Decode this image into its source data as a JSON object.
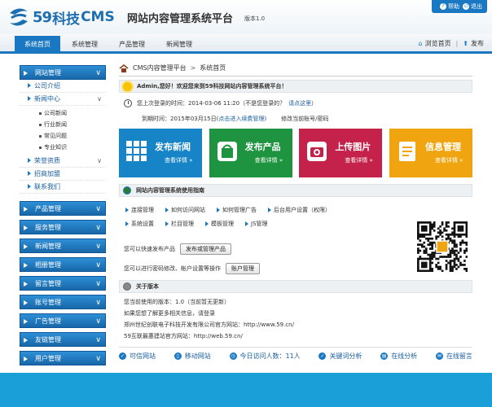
{
  "brand": {
    "logo_59": "59",
    "logo_tech": "科技",
    "logo_cms": "CMS",
    "system_title": "网站内容管理系统平台",
    "version": "版本1.0"
  },
  "top_links": {
    "help": "帮助",
    "logout": "退出"
  },
  "nav": {
    "tabs": [
      "系统首页",
      "系统管理",
      "产品管理",
      "新闻管理"
    ],
    "browse": "浏览首页",
    "publish": "发布"
  },
  "sidebar": {
    "site_manage": "网站管理",
    "company_intro": "公司介绍",
    "news_center": "新闻中心",
    "news_subs": [
      "公司新闻",
      "行业新闻",
      "常见问题",
      "专业知识"
    ],
    "honors": "荣誉资质",
    "recruit": "招商加盟",
    "contact": "联系我们",
    "groups": [
      "产品管理",
      "服务管理",
      "新闻管理",
      "相册管理",
      "留言管理",
      "账号管理",
      "广告管理",
      "友链管理",
      "用户管理"
    ]
  },
  "breadcrumb": {
    "root": "CMS内容管理平台",
    "current": "系统首页"
  },
  "welcome": "Admin,您好！欢迎您来到59科技网站内容管理系统平台！",
  "last_login": {
    "text": "您上次登录的时间：2014-03-06 11:20（不是您登录的？",
    "link": "请点这里",
    "close": "）"
  },
  "expire": {
    "text": "到期时间：2015年03月15日(",
    "link": "点击进入续费管理",
    "close": ")",
    "account": "修改当前账号/密码"
  },
  "tiles": [
    {
      "name": "发布新闻",
      "more": "查看详情 »"
    },
    {
      "name": "发布产品",
      "more": "查看详情 »"
    },
    {
      "name": "上传图片",
      "more": "查看详情 »"
    },
    {
      "name": "信息管理",
      "more": "查看详情 »"
    }
  ],
  "guide": {
    "title": "网站内容管理系统使用指南",
    "row1": [
      "连接管理",
      "如何访问网站",
      "如何管理广告",
      "后台用户设置（权限）"
    ],
    "row2": [
      "系统设置",
      "栏目管理",
      "模板管理",
      "JS管理"
    ],
    "publish_text": "您可以快速发布产品",
    "publish_btn": "发布或管理产品",
    "account_text": "您可以进行密码修改、帐户设置等操作",
    "account_btn": "账户管理"
  },
  "about": {
    "title": "关于版本",
    "lines": [
      "您当前使用的版本：1.0（当前暂无更新）",
      "如果您想了解更多相关信息，请登录",
      "郑州世纪创联电子科技开发有限公司官方网站：http://www.59.cn/",
      "59互联最惠建站官方网站：http://web.59.cn/"
    ]
  },
  "footer": [
    "可信网站",
    "移动网站",
    "今日访问人数：11人",
    "关键词分析",
    "在线分析",
    "在线留言"
  ],
  "colors": {
    "primary": "#1a78c2",
    "tile_news": "#1684c7",
    "tile_product": "#1f9440",
    "tile_image": "#c4224a",
    "tile_info": "#f0a510",
    "bottom_bar": "#1b9fd8"
  }
}
